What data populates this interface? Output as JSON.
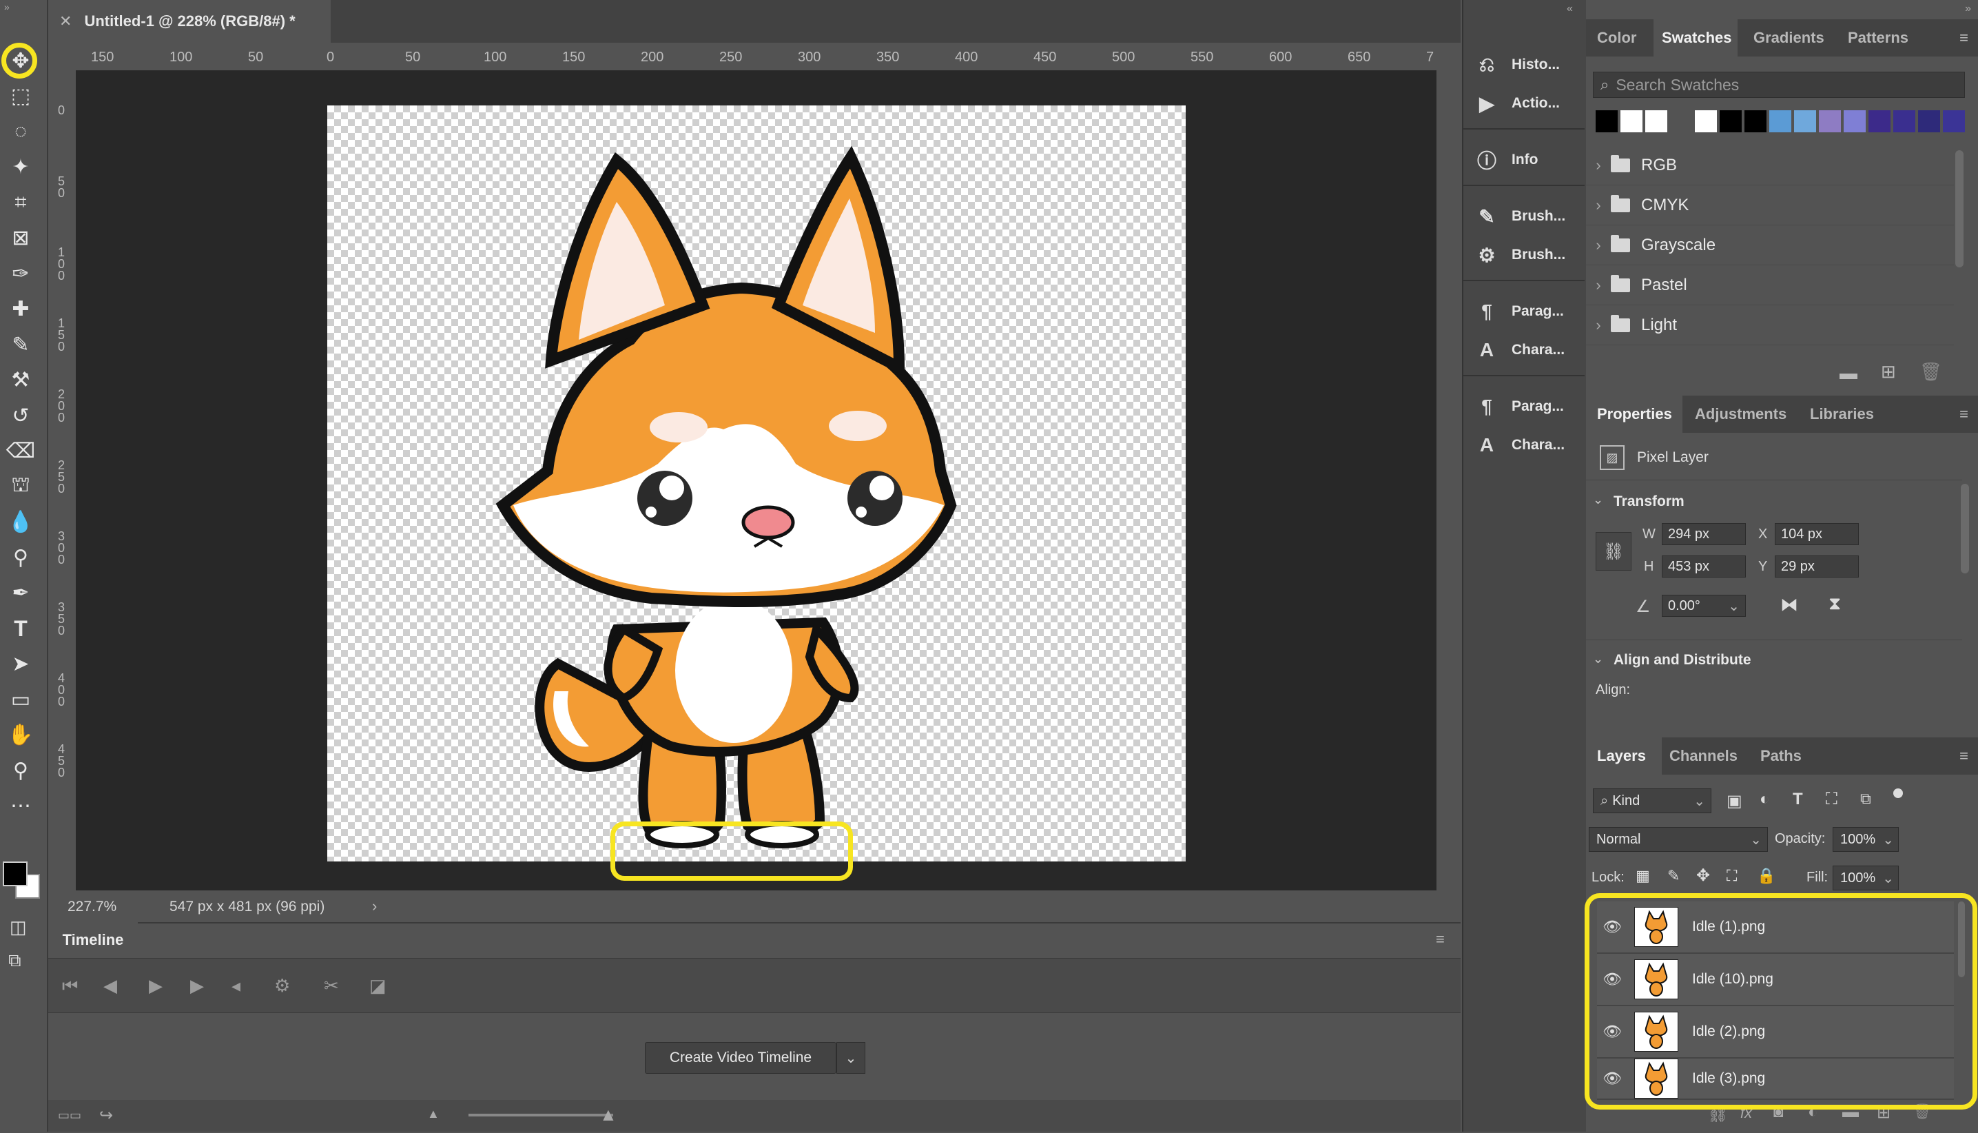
{
  "document": {
    "tab_title": "Untitled-1 @ 228% (RGB/8#) *",
    "zoom": "227.7%",
    "doc_info": "547 px x 481 px (96 ppi)"
  },
  "rulers": {
    "horizontal": [
      "150",
      "100",
      "50",
      "0",
      "50",
      "100",
      "150",
      "200",
      "250",
      "300",
      "350",
      "400",
      "450",
      "500",
      "550",
      "600",
      "650",
      "7"
    ],
    "vertical": [
      "0",
      "5 0",
      "1 0 0",
      "1 5 0",
      "2 0 0",
      "2 5 0",
      "3 0 0",
      "3 5 0",
      "4 0 0",
      "4 5 0"
    ]
  },
  "toolbar": {
    "tools": [
      "move-tool",
      "marquee-tool",
      "lasso-tool",
      "magic-wand-tool",
      "crop-tool",
      "frame-tool",
      "eyedropper-tool",
      "healing-brush-tool",
      "brush-tool",
      "clone-stamp-tool",
      "history-brush-tool",
      "eraser-tool",
      "paint-bucket-tool",
      "blur-tool",
      "dodge-tool",
      "pen-tool",
      "type-tool",
      "path-selection-tool",
      "rectangle-tool",
      "hand-tool",
      "zoom-tool",
      "more-tools"
    ]
  },
  "timeline": {
    "title": "Timeline",
    "create_button": "Create Video Timeline"
  },
  "dock": {
    "items": [
      {
        "label": "Histo...",
        "icon": "history-icon"
      },
      {
        "label": "Actio...",
        "icon": "play-icon"
      },
      {
        "label": "Info",
        "icon": "info-icon"
      },
      {
        "label": "Brush...",
        "icon": "brush-icon"
      },
      {
        "label": "Brush...",
        "icon": "brush-settings-icon"
      },
      {
        "label": "Parag...",
        "icon": "paragraph-icon"
      },
      {
        "label": "Chara...",
        "icon": "character-icon"
      },
      {
        "label": "Parag...",
        "icon": "paragraph-styles-icon"
      },
      {
        "label": "Chara...",
        "icon": "character-styles-icon"
      }
    ]
  },
  "swatches_panel": {
    "tabs": [
      "Color",
      "Swatches",
      "Gradients",
      "Patterns"
    ],
    "active_tab": "Swatches",
    "search_placeholder": "Search Swatches",
    "swatch_colors": [
      "#000000",
      "#ffffff",
      "#ffffff",
      "#535353",
      "#ffffff",
      "#000000",
      "#000000",
      "#5b9bd5",
      "#6fa8dc",
      "#8e7cc3",
      "#7f7fd5",
      "#3c2a8a",
      "#3a2f8f",
      "#2e2a7a",
      "#3b3496"
    ],
    "groups": [
      "RGB",
      "CMYK",
      "Grayscale",
      "Pastel",
      "Light"
    ]
  },
  "properties_panel": {
    "tabs": [
      "Properties",
      "Adjustments",
      "Libraries"
    ],
    "active_tab": "Properties",
    "layer_type": "Pixel Layer",
    "transform_title": "Transform",
    "w_label": "W",
    "w_value": "294 px",
    "h_label": "H",
    "h_value": "453 px",
    "x_label": "X",
    "x_value": "104 px",
    "y_label": "Y",
    "y_value": "29 px",
    "angle_value": "0.00°",
    "align_title": "Align and Distribute",
    "align_label": "Align:"
  },
  "layers_panel": {
    "tabs": [
      "Layers",
      "Channels",
      "Paths"
    ],
    "active_tab": "Layers",
    "filter_kind": "Kind",
    "blend_mode": "Normal",
    "opacity_label": "Opacity:",
    "opacity_value": "100%",
    "lock_label": "Lock:",
    "fill_label": "Fill:",
    "fill_value": "100%",
    "layers": [
      "Idle (1).png",
      "Idle (10).png",
      "Idle (2).png",
      "Idle (3).png"
    ]
  },
  "highlight_color": "#f7e521"
}
